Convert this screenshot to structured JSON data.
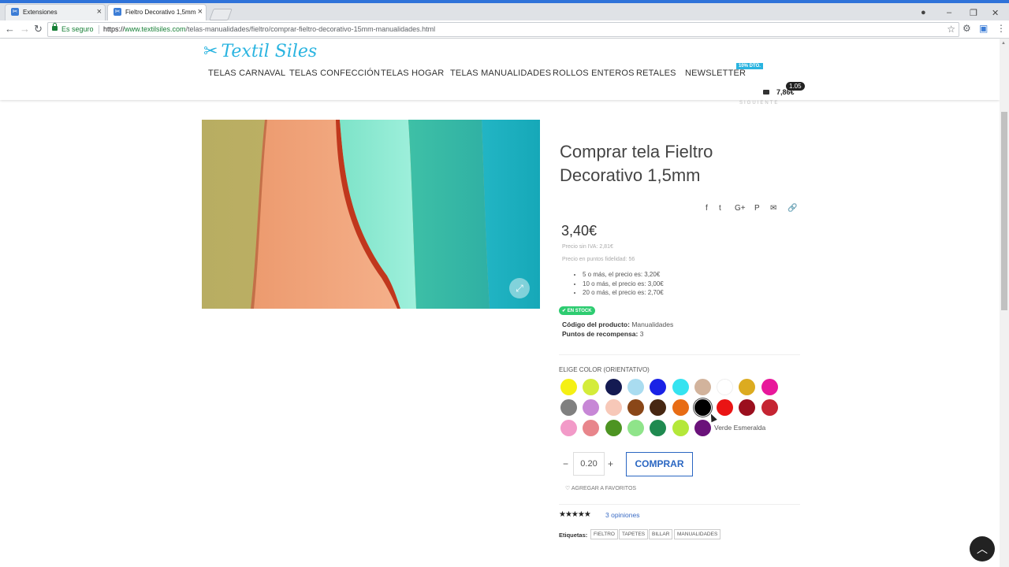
{
  "browser": {
    "tabs": [
      {
        "title": "Extensiones",
        "active": false
      },
      {
        "title": "Fieltro Decorativo 1,5mm",
        "active": true
      }
    ],
    "secure_label": "Es seguro",
    "url_scheme": "https://",
    "url_host": "www.textilsiles.com",
    "url_path": "/telas-manualidades/fieltro/comprar-fieltro-decorativo-15mm-manualidades.html"
  },
  "site": {
    "logo_text": "Textil Siles",
    "nav": [
      "TELAS CARNAVAL",
      "TELAS CONFECCIÓN",
      "TELAS HOGAR",
      "TELAS MANUALIDADES",
      "ROLLOS ENTEROS",
      "RETALES",
      "NEWSLETTER"
    ],
    "promo_badge": "10% DTO.",
    "cart_price": "7,86€",
    "cart_count": "1.05",
    "siguiente": "SIGUIENTE"
  },
  "product": {
    "title": "Comprar tela Fieltro Decorativo 1,5mm",
    "price": "3,40€",
    "price_no_vat": "Precio sin IVA: 2,81€",
    "price_points": "Precio en puntos fidelidad: 56",
    "tiers": [
      "5 o más, el precio es: 3,20€",
      "10 o más, el precio es: 3,00€",
      "20 o más, el precio es: 2,70€"
    ],
    "stock": "EN STOCK",
    "code_label": "Código del producto:",
    "code_value": "Manualidades",
    "points_label": "Puntos de recompensa:",
    "points_value": "3",
    "color_label": "ELIGE COLOR (ORIENTATIVO)",
    "colors": [
      "#f5f014",
      "#d4ec3a",
      "#141a52",
      "#a9dcf0",
      "#1a22e6",
      "#35e3f0",
      "#d2b39c",
      "#ffffff",
      "#dcab20",
      "#e8189b",
      "#808080",
      "#c787d6",
      "#f7c8b8",
      "#8a4718",
      "#472712",
      "#e86c14",
      "#000000",
      "#ea1414",
      "#9b0f1e",
      "#c52432",
      "#f29ac8",
      "#e8858b",
      "#4d9422",
      "#8fe48a",
      "#1f8a50",
      "#b4e83a",
      "#6a127a"
    ],
    "selected_color_index": 16,
    "hover_color_name": "Verde Esmeralda",
    "quantity": "0.20",
    "buy_label": "COMPRAR",
    "favorites_label": "AGREGAR A FAVORITOS",
    "rating": 5,
    "reviews": "3 opiniones",
    "tags_label": "Etiquetas:",
    "tags": [
      "FIELTRO",
      "TAPETES",
      "BILLAR",
      "MANUALIDADES"
    ]
  }
}
